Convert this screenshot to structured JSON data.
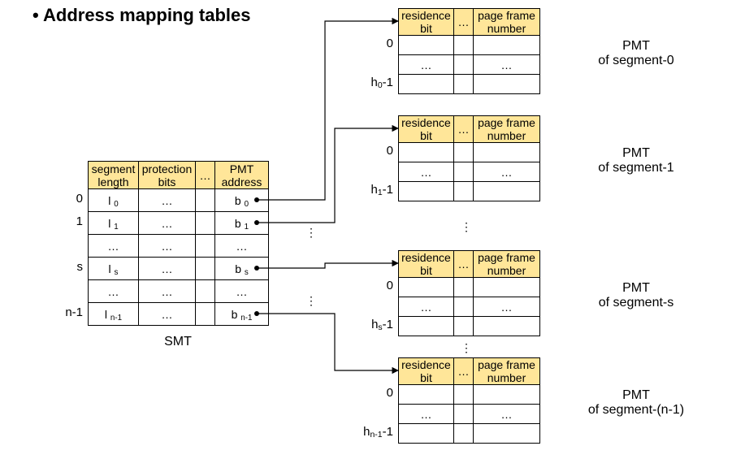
{
  "title": "Address mapping tables",
  "smt": {
    "headers": {
      "seglen": "segment\nlength",
      "prot": "protection\nbits",
      "dots": "…",
      "pmt": "PMT\naddress"
    },
    "rows": [
      {
        "idx": "0",
        "len_html": "l <span class='sub-inline'>0</span>",
        "prot": "…",
        "dots": "",
        "pmt_html": "b <span class='sub-inline'>0</span>"
      },
      {
        "idx": "1",
        "len_html": "l <span class='sub-inline'>1</span>",
        "prot": "…",
        "dots": "",
        "pmt_html": "b <span class='sub-inline'>1</span>"
      },
      {
        "idx": "",
        "len_html": "…",
        "prot": "…",
        "dots": "",
        "pmt_html": "…"
      },
      {
        "idx": "s",
        "len_html": "l <span class='sub-inline'>s</span>",
        "prot": "…",
        "dots": "",
        "pmt_html": "b <span class='sub-inline'>s</span>"
      },
      {
        "idx": "",
        "len_html": "…",
        "prot": "…",
        "dots": "",
        "pmt_html": "…"
      },
      {
        "idx": "n-1",
        "len_html": "l <span class='sub-inline'>n-1</span>",
        "prot": "…",
        "dots": "",
        "pmt_html": "b <span class='sub-inline'>n-1</span>"
      }
    ],
    "caption": "SMT"
  },
  "pmt_headers": {
    "res": "residence\nbit",
    "dots": "…",
    "pfn": "page frame\nnumber"
  },
  "pmts": [
    {
      "first": "0",
      "mid1": "…",
      "mid2": "…",
      "last_html": "h<sub>0</sub>-1",
      "caption_html": "PMT<br>of segment-0"
    },
    {
      "first": "0",
      "mid1": "…",
      "mid2": "…",
      "last_html": "h<sub>1</sub>-1",
      "caption_html": "PMT<br>of segment-1"
    },
    {
      "first": "0",
      "mid1": "…",
      "mid2": "…",
      "last_html": "h<sub>s</sub>-1",
      "caption_html": "PMT<br>of segment-s"
    },
    {
      "first": "0",
      "mid1": "…",
      "mid2": "…",
      "last_html": "h<sub>n-1</sub>-1",
      "caption_html": "PMT<br>of segment-(n-1)"
    }
  ]
}
